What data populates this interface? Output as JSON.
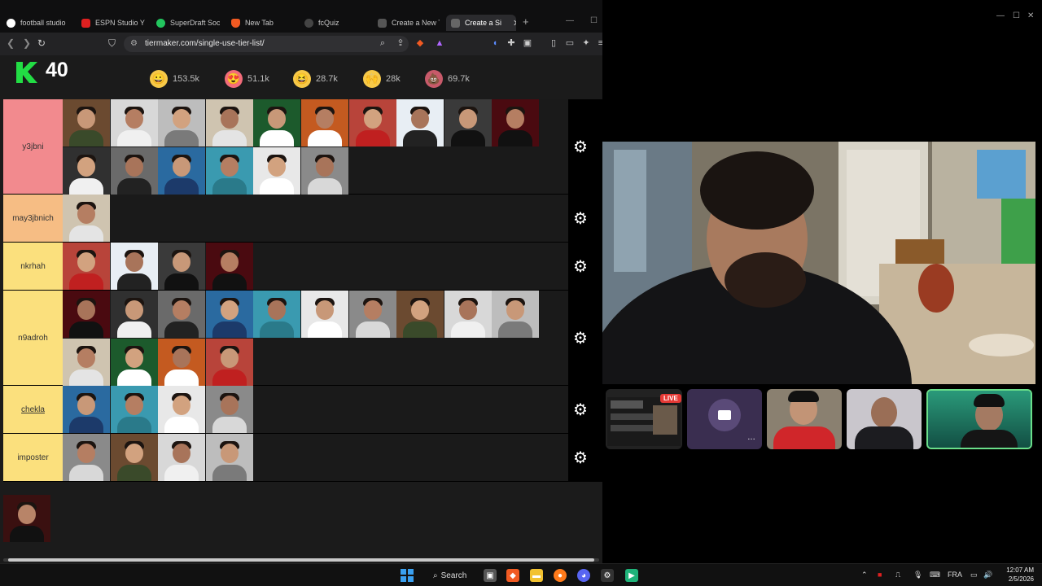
{
  "browser": {
    "tabs": [
      {
        "label": "football studio",
        "color": "#ffffff"
      },
      {
        "label": "ESPN Studio Y B",
        "color": "#e02020"
      },
      {
        "label": "SuperDraft Socc",
        "color": "#22c55e"
      },
      {
        "label": "New Tab",
        "color": "#f15a22"
      },
      {
        "label": "fcQuiz",
        "color": "#888888"
      },
      {
        "label": "Create a New Ti",
        "color": "#888888"
      },
      {
        "label": "Create a Si",
        "color": "#888888",
        "active": true
      }
    ],
    "url": "tiermaker.com/single-use-tier-list/"
  },
  "page": {
    "score": "40",
    "reactions": [
      {
        "icon": "grinning-face-icon",
        "glyph": "😀",
        "count": "153.5k"
      },
      {
        "icon": "heart-eyes-icon",
        "glyph": "😍",
        "count": "51.1k"
      },
      {
        "icon": "laughing-face-icon",
        "glyph": "😆",
        "count": "28.7k"
      },
      {
        "icon": "raised-hands-icon",
        "glyph": "🙌",
        "count": "28k"
      },
      {
        "icon": "poop-icon",
        "glyph": "💩",
        "count": "69.7k"
      }
    ],
    "tiers": [
      {
        "label": "y3jbni",
        "color": "#f28a8e",
        "count": 16
      },
      {
        "label": "may3jbnich",
        "color": "#f6bd84",
        "count": 1
      },
      {
        "label": "nkrhah",
        "color": "#fbe07d",
        "count": 4
      },
      {
        "label": "n9adroh",
        "color": "#fbe07d",
        "count": 14
      },
      {
        "label": "chekla",
        "color": "#fbe07d",
        "count": 4
      },
      {
        "label": "imposter",
        "color": "#fbe07d",
        "count": 4
      }
    ]
  },
  "call": {
    "live_label": "LIVE"
  },
  "taskbar": {
    "search_label": "Search",
    "lang": "FRA",
    "time": "12:07 AM",
    "date": "2/5/2026"
  }
}
